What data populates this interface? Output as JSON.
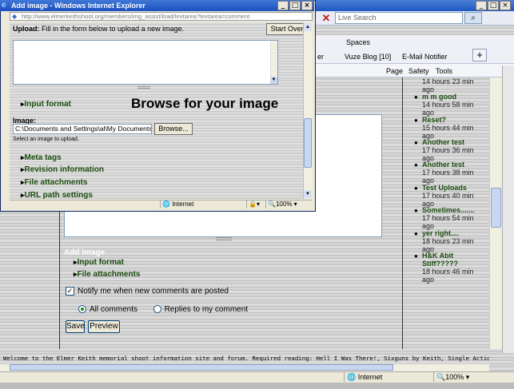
{
  "background": {
    "search_placeholder": "Live Search",
    "toolbar": {
      "spaces": "Spaces",
      "vuze_blog": "Vuze Blog [10]",
      "email_notifier": "E-Mail Notifier",
      "page_menu": "Page",
      "safety_menu": "Safety",
      "tools_menu": "Tools",
      "partial_r": "er"
    },
    "form": {
      "add_image_label": "Add image",
      "input_format": "Input format",
      "file_attachments": "File attachments",
      "notify_label": "Notify me when new comments are posted",
      "radio_all": "All comments",
      "radio_replies": "Replies to my comment",
      "save": "Save",
      "preview": "Preview"
    },
    "sidebar": [
      {
        "title": "",
        "meta": "14 hours 23 min ago"
      },
      {
        "title": "m m good",
        "meta": "14 hours 58 min ago"
      },
      {
        "title": "Reset?",
        "meta": "15 hours 44 min ago"
      },
      {
        "title": "Another test",
        "meta": "17 hours 36 min ago"
      },
      {
        "title": "Another test",
        "meta": "17 hours 38 min ago"
      },
      {
        "title": "Test Uploads",
        "meta": "17 hours 40 min ago"
      },
      {
        "title": "Sometimes.......",
        "meta": "17 hours 54 min ago"
      },
      {
        "title": "yer right....",
        "meta": "18 hours 23 min ago"
      },
      {
        "title": "H&K Abit Stiff?????",
        "meta": "18 hours 46 min ago"
      }
    ],
    "footer": "Welcome to the Elmer Keith memorial shoot information site and forum. Required reading: Hell I Was There!, Sixguns by Keith, Single Action Sixguns, Book of the 44",
    "status": {
      "zone": "Internet",
      "zoom": "100%"
    }
  },
  "popup": {
    "title": "Add image - Windows Internet Explorer",
    "url": "http://www.elmerkeithshoot.org/members/img_assist/load/textarea?textarea=comment",
    "upload_label": "Upload:",
    "upload_text": "Fill in the form below to upload a new image.",
    "start_over": "Start Over",
    "input_format": "Input format",
    "browse_heading": "Browse for your image",
    "image_label": "Image:",
    "file_value": "C:\\Documents and Settings\\al\\My Documents\\",
    "browse_button": "Browse...",
    "select_help": "Select an image to upload.",
    "fieldsets": [
      "Meta tags",
      "Revision information",
      "File attachments",
      "URL path settings"
    ],
    "status": {
      "zone": "Internet",
      "zoom": "100%"
    }
  }
}
